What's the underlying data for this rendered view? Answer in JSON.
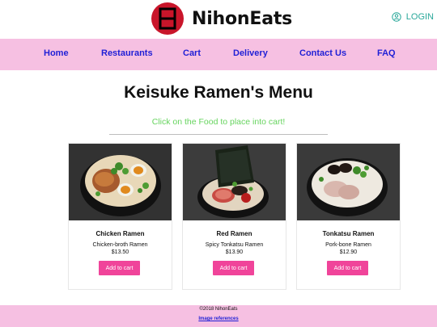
{
  "header": {
    "brand": "NihonEats",
    "login_label": "LOGIN",
    "login_icon": "user-circle-icon",
    "logo_icon": "kanji-sun-logo-icon"
  },
  "nav": {
    "items": [
      {
        "label": "Home"
      },
      {
        "label": "Restaurants"
      },
      {
        "label": "Cart"
      },
      {
        "label": "Delivery"
      },
      {
        "label": "Contact Us"
      },
      {
        "label": "FAQ"
      }
    ]
  },
  "main": {
    "title": "Keisuke Ramen's Menu",
    "hint": "Click on the Food to place into cart!",
    "items": [
      {
        "name": "Chicken Ramen",
        "desc": "Chicken-broth Ramen",
        "price": "$13.50",
        "button": "Add to cart"
      },
      {
        "name": "Red Ramen",
        "desc": "Spicy Tonkatsu Ramen",
        "price": "$13.90",
        "button": "Add to cart"
      },
      {
        "name": "Tonkatsu Ramen",
        "desc": "Pork-bone Ramen",
        "price": "$12.90",
        "button": "Add to cart"
      }
    ]
  },
  "footer": {
    "copyright": "©2018 NihonEats",
    "references": "Image references"
  },
  "colors": {
    "nav_bg": "#f6c0e2",
    "nav_link": "#1f1fd6",
    "button": "#f0449a",
    "hint": "#66d45e",
    "logo": "#c9152a",
    "login": "#2aa89a"
  }
}
